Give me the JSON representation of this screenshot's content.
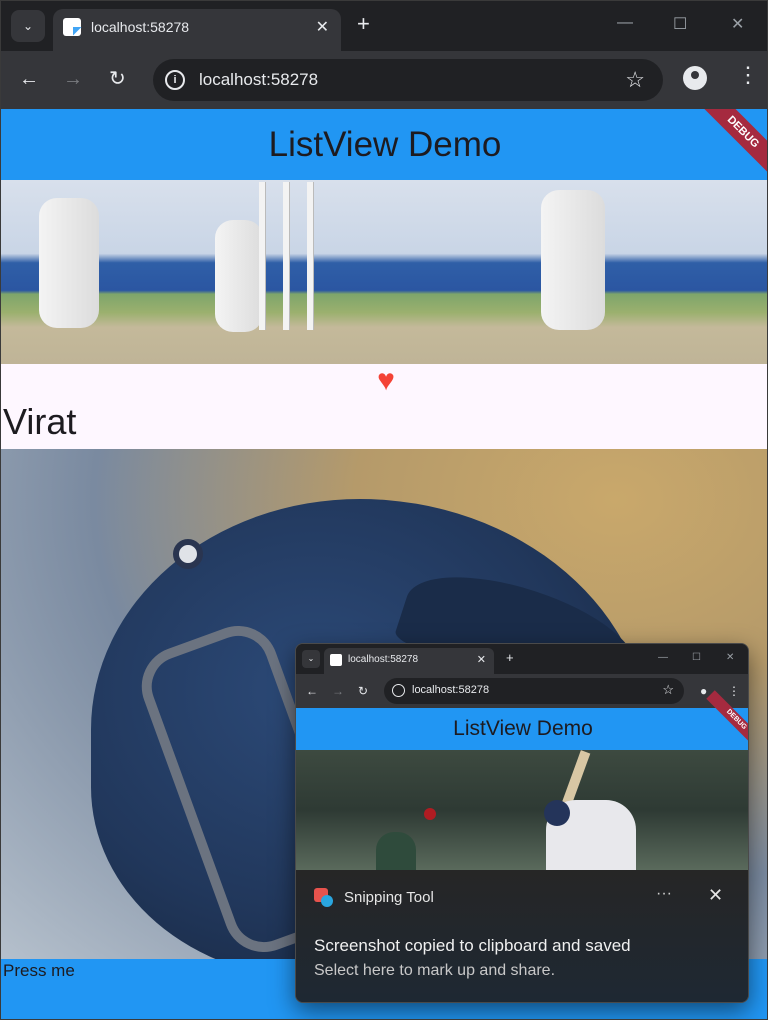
{
  "browser": {
    "tab_title": "localhost:58278",
    "url": "localhost:58278",
    "new_tab_glyph": "+",
    "close_glyph": "✕",
    "minimize_glyph": "—",
    "maximize_glyph": "☐",
    "window_close_glyph": "✕",
    "back_glyph": "←",
    "forward_glyph": "→",
    "reload_glyph": "↻",
    "star_glyph": "☆",
    "menu_glyph": "⋮",
    "tab_search_glyph": "⌄"
  },
  "app": {
    "title": "ListView Demo",
    "debug_banner": "DEBUG",
    "heart_glyph": "♥",
    "item_name": "Virat",
    "button_label": "Press me",
    "colors": {
      "app_bar": "#2196f3",
      "heart": "#f44336",
      "background": "#fef7ff"
    }
  },
  "snipping_tool": {
    "app_name": "Snipping Tool",
    "more_glyph": "···",
    "close_glyph": "✕",
    "message_title": "Screenshot copied to clipboard and saved",
    "message_body": "Select here to mark up and share.",
    "preview": {
      "tab_title": "localhost:58278",
      "url": "localhost:58278",
      "app_title": "ListView Demo",
      "debug_banner": "DEBUG"
    }
  }
}
